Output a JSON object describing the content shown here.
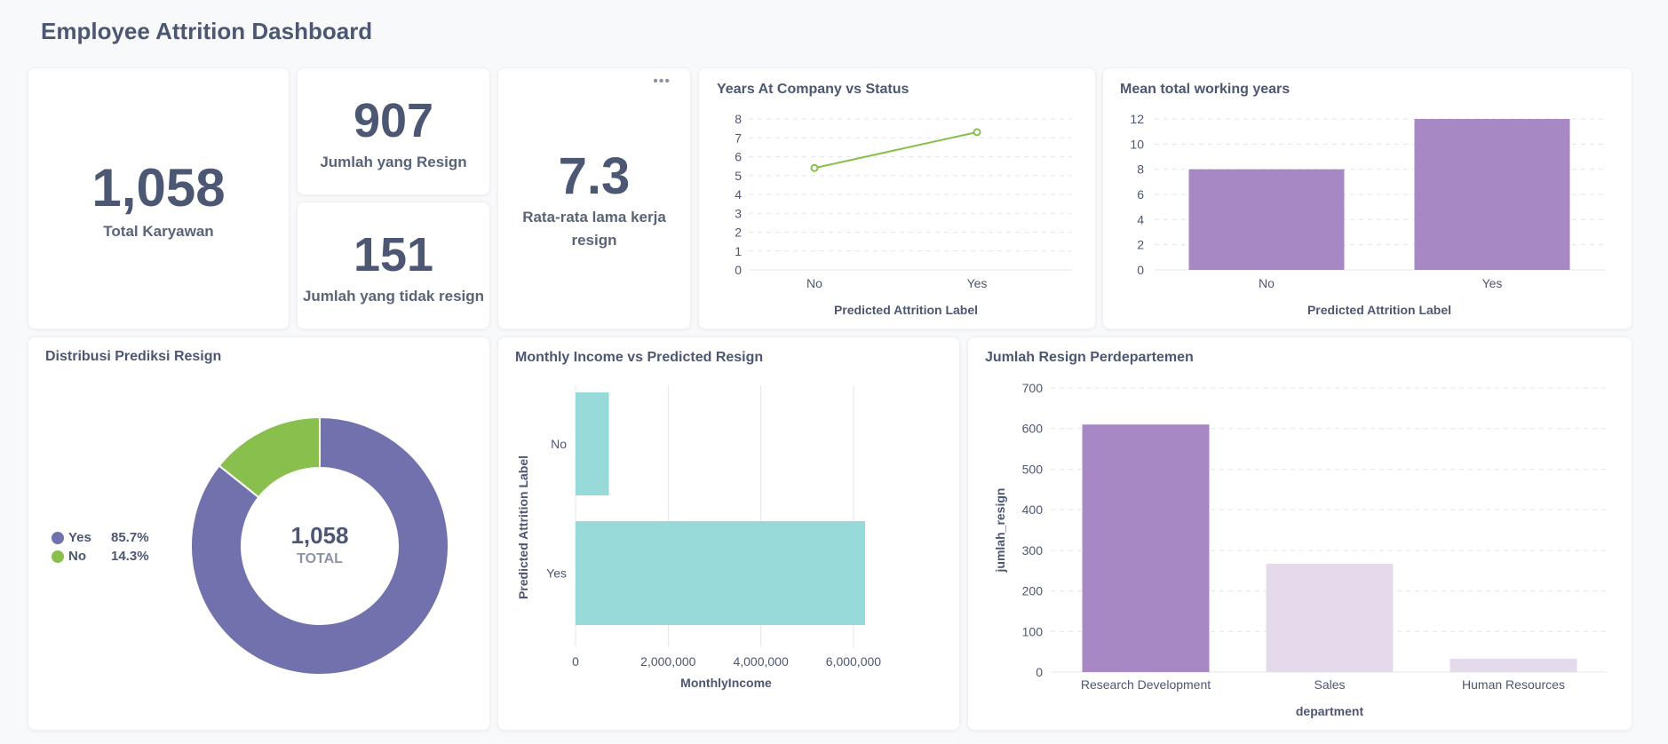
{
  "dashboard": {
    "title": "Employee Attrition Dashboard"
  },
  "kpis": {
    "total": {
      "value": "1,058",
      "label": "Total Karyawan"
    },
    "resign": {
      "value": "907",
      "label": "Jumlah yang Resign"
    },
    "not_resign": {
      "value": "151",
      "label": "Jumlah yang tidak resign"
    },
    "avg_years": {
      "value": "7.3",
      "label_line1": "Rata-rata lama kerja",
      "label_line2": "resign",
      "menu_icon": "ellipsis-icon"
    }
  },
  "colors": {
    "purple": "#a788c5",
    "light_purple": "#e5d9ec",
    "donut_yes": "#7172ad",
    "green": "#88bf4d",
    "teal": "#98d9d9",
    "grid": "#e3e6ea",
    "text": "#4c5773"
  },
  "chart_data": [
    {
      "id": "years_at_company",
      "type": "line",
      "title": "Years At Company vs Status",
      "categories": [
        "No",
        "Yes"
      ],
      "series": [
        {
          "values": [
            5.4,
            7.3
          ]
        }
      ],
      "xlabel": "Predicted Attrition Label",
      "ylabel": "",
      "ylim": [
        0,
        8
      ],
      "yticks": [
        "0",
        "1",
        "2",
        "3",
        "4",
        "5",
        "6",
        "7",
        "8"
      ],
      "grid": true
    },
    {
      "id": "mean_working_years",
      "type": "bar",
      "title": "Mean total working years",
      "categories": [
        "No",
        "Yes"
      ],
      "values": [
        8,
        12
      ],
      "xlabel": "Predicted Attrition Label",
      "ylabel": "",
      "ylim": [
        0,
        12
      ],
      "yticks": [
        "0",
        "2",
        "4",
        "6",
        "8",
        "10",
        "12"
      ],
      "grid": true
    },
    {
      "id": "distribusi",
      "type": "pie",
      "title": "Distribusi Prediksi Resign",
      "labels": [
        "Yes",
        "No"
      ],
      "percent_labels": [
        "85.7%",
        "14.3%"
      ],
      "values": [
        907,
        151
      ],
      "center_value": "1,058",
      "center_label": "TOTAL",
      "legend": "left"
    },
    {
      "id": "monthly_income",
      "type": "bar",
      "orientation": "horizontal",
      "title": "Monthly Income vs Predicted Resign",
      "categories": [
        "No",
        "Yes"
      ],
      "values": [
        720000,
        6250000
      ],
      "xlabel": "MonthlyIncome",
      "ylabel": "Predicted Attrition Label",
      "xlim": [
        0,
        6500000
      ],
      "xticks": [
        "0",
        "2,000,000",
        "4,000,000",
        "6,000,000"
      ],
      "grid": true
    },
    {
      "id": "resign_per_department",
      "type": "bar",
      "title": "Jumlah Resign Perdepartemen",
      "categories": [
        "Research Development",
        "Sales",
        "Human Resources"
      ],
      "values": [
        610,
        267,
        33
      ],
      "xlabel": "department",
      "ylabel": "jumlah_resign",
      "ylim": [
        0,
        700
      ],
      "yticks": [
        "0",
        "100",
        "200",
        "300",
        "400",
        "500",
        "600",
        "700"
      ],
      "grid": true
    }
  ]
}
